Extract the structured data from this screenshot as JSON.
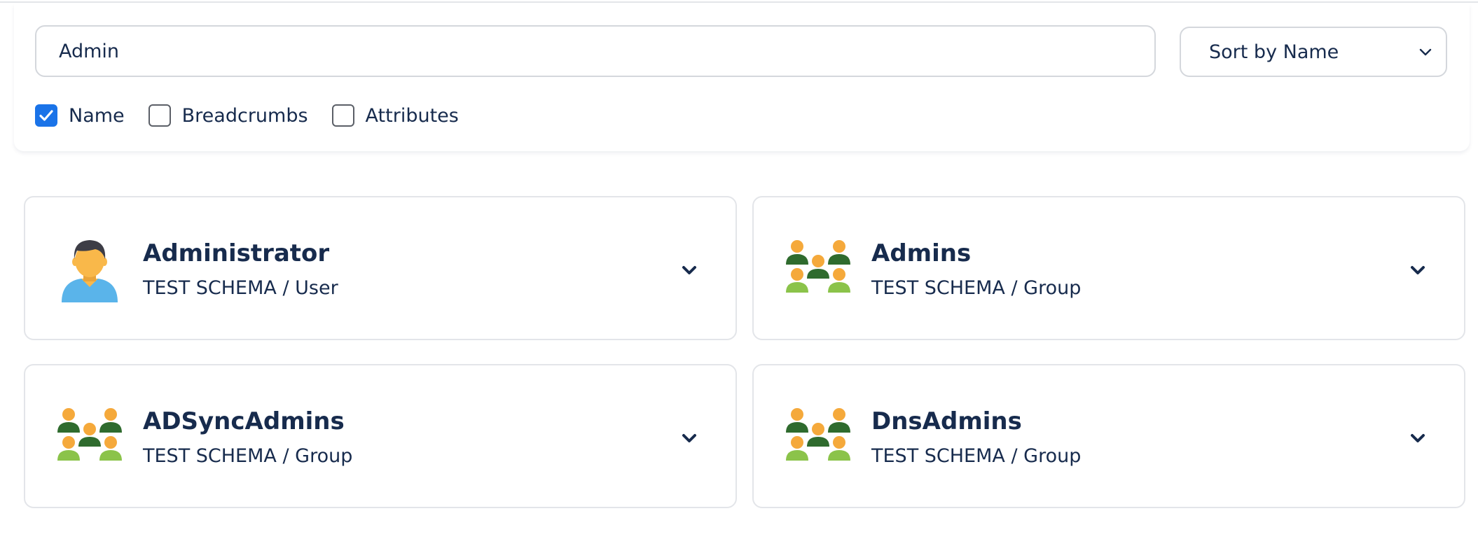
{
  "search": {
    "value": "Admin",
    "sort_label": "Sort by Name",
    "filters": [
      {
        "label": "Name",
        "checked": true
      },
      {
        "label": "Breadcrumbs",
        "checked": false
      },
      {
        "label": "Attributes",
        "checked": false
      }
    ]
  },
  "results": [
    {
      "title": "Administrator",
      "subtitle": "TEST SCHEMA / User",
      "icon": "user-icon"
    },
    {
      "title": "Admins",
      "subtitle": "TEST SCHEMA / Group",
      "icon": "group-icon"
    },
    {
      "title": "ADSyncAdmins",
      "subtitle": "TEST SCHEMA / Group",
      "icon": "group-icon"
    },
    {
      "title": "DnsAdmins",
      "subtitle": "TEST SCHEMA / Group",
      "icon": "group-icon"
    }
  ],
  "colors": {
    "checkbox_accent": "#1a73e8",
    "text": "#172b4d",
    "border": "#e3e5e9",
    "group_orange": "#f5a93b",
    "group_dark_green": "#2f6b2e",
    "group_light_green": "#8bc34a",
    "user_skin": "#f9b84a",
    "user_shirt": "#5ab4ea",
    "user_hair": "#3d3d46"
  }
}
